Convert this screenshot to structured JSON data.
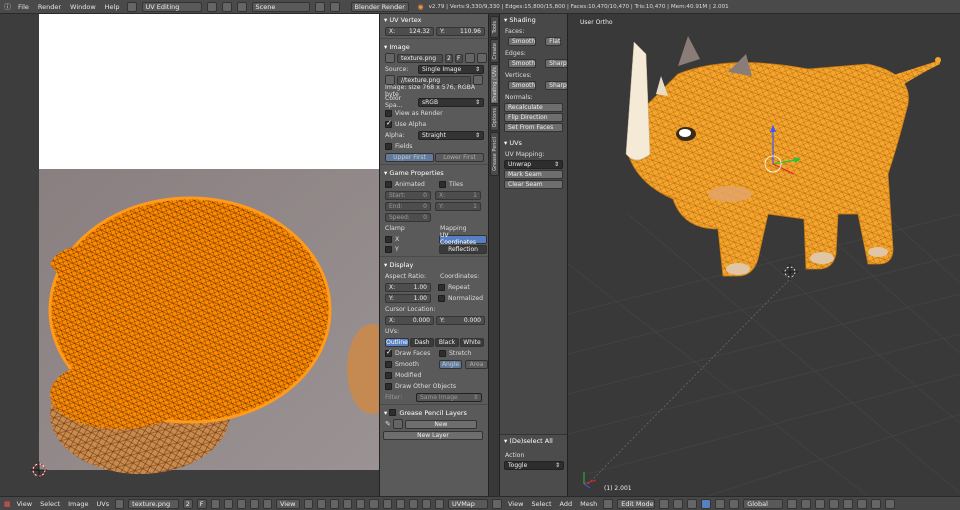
{
  "topbar": {
    "menus": [
      "File",
      "Render",
      "Window",
      "Help"
    ],
    "screen_layout": "UV Editing",
    "scene": "Scene",
    "render_engine": "Blender Render",
    "stats": "v2.79 | Verts:9,330/9,330 | Edges:15,800/15,800 | Faces:10,470/10,470 | Tris:10,470 | Mem:40.91M | 2.001"
  },
  "properties": {
    "uv_vertex": {
      "header": "UV Vertex",
      "x_label": "X:",
      "x_value": "124.32",
      "y_label": "Y:",
      "y_value": "110.96"
    },
    "image": {
      "header": "Image",
      "name": "texture.png",
      "users": "2",
      "fake": "F",
      "source_label": "Source:",
      "source": "Single Image",
      "path": "//texture.png",
      "info": "Image: size 768 x 576, RGBA byte",
      "color_space_label": "Color Spa...",
      "color_space": "sRGB",
      "view_as_render": "View as Render",
      "use_alpha": "Use Alpha",
      "alpha_label": "Alpha:",
      "alpha": "Straight",
      "fields": "Fields",
      "upper_first": "Upper First",
      "lower_first": "Lower First"
    },
    "game": {
      "header": "Game Properties",
      "animated": "Animated",
      "tiles": "Tiles",
      "start": "Start:",
      "start_val": "0",
      "end": "End:",
      "end_val": "0",
      "speed": "Speed:",
      "speed_val": "0",
      "tx": "X:",
      "tx_val": "1",
      "ty": "Y:",
      "ty_val": "1",
      "clamp": "Clamp",
      "mapping": "Mapping",
      "cx": "X",
      "cy": "Y",
      "uv_coords": "UV Coordinates",
      "reflection": "Reflection"
    },
    "display": {
      "header": "Display",
      "aspect_ratio": "Aspect Ratio:",
      "ax": "X:",
      "ax_val": "1.00",
      "ay": "Y:",
      "ay_val": "1.00",
      "coordinates": "Coordinates:",
      "repeat": "Repeat",
      "normalized": "Normalized",
      "cursor_location": "Cursor Location:",
      "cur_x": "X:",
      "cur_x_val": "0.000",
      "cur_y": "Y:",
      "cur_y_val": "0.000",
      "uvs": "UVs:",
      "outline": "Outline",
      "dash": "Dash",
      "black": "Black",
      "white": "White",
      "draw_faces": "Draw Faces",
      "stretch": "Stretch",
      "smooth": "Smooth",
      "angle": "Angle",
      "area": "Area",
      "modified": "Modified",
      "draw_other": "Draw Other Objects",
      "filter_label": "Filter:",
      "filter": "Same Image"
    },
    "grease": {
      "header": "Grease Pencil Layers",
      "new": "New",
      "new_layer": "New Layer"
    }
  },
  "vtabs": [
    "Tools",
    "Create",
    "Shading / UVs",
    "Options",
    "Grease Pencil"
  ],
  "tools": {
    "shading_header": "Shading",
    "faces": "Faces:",
    "smooth": "Smooth",
    "flat": "Flat",
    "edges": "Edges:",
    "sharp": "Sharp",
    "vertices": "Vertices:",
    "normals": "Normals:",
    "recalculate": "Recalculate",
    "flip_direction": "Flip Direction",
    "set_from_faces": "Set From Faces",
    "uvs_header": "UVs",
    "uv_mapping": "UV Mapping:",
    "unwrap": "Unwrap",
    "mark_seam": "Mark Seam",
    "clear_seam": "Clear Seam",
    "op_header": "(De)select All",
    "action_label": "Action",
    "action": "Toggle"
  },
  "viewport": {
    "view_name": "User Ortho",
    "object_info": "(1) 2.001"
  },
  "bottom_uv": {
    "menus": [
      "View",
      "Select",
      "Image",
      "UVs"
    ],
    "image_name": "texture.png",
    "users": "2",
    "fake": "F",
    "view": "View",
    "uvmap": "UVMap"
  },
  "bottom_3d": {
    "menus": [
      "View",
      "Select",
      "Add",
      "Mesh"
    ],
    "mode": "Edit Mode",
    "orientation": "Global"
  },
  "colors": {
    "accent_orange": "#ff8a00",
    "selected_blue": "#5680c2"
  }
}
